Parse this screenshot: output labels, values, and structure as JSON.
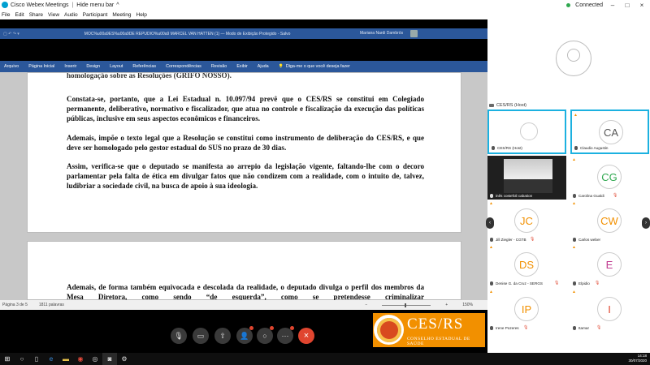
{
  "app": {
    "title": "Cisco Webex Meetings",
    "hide_menu": "Hide menu bar",
    "hide_menu_arrow": "^",
    "connection": "Connected"
  },
  "menu": [
    "File",
    "Edit",
    "Share",
    "View",
    "Audio",
    "Participant",
    "Meeting",
    "Help"
  ],
  "word": {
    "doc_title": "MOC%u00a9ES%u00a9DE REPUDIO%u00a9 MARCEL VAN HATTEN (1) — Modo de Exibição Protegido - Salvo",
    "user": "Mariana Nardi Dambrós",
    "ribbon_tabs": [
      "Arquivo",
      "Página Inicial",
      "Inserir",
      "Design",
      "Layout",
      "Referências",
      "Correspondências",
      "Revisão",
      "Exibir",
      "Ajuda"
    ],
    "tell_me": "Diga-me o que você deseja fazer",
    "paragraphs": [
      "homologação sobre as Resoluções (GRIFO NOSSO).",
      "Constata-se, portanto, que a Lei Estadual n. 10.097/94 prevê que o CES/RS se constitui em Colegiado permanente, deliberativo, normativo e fiscalizador, que atua no controle e fiscalização da execução das políticas públicas, inclusive em seus aspectos econômicos e financeiros.",
      "Ademais, impõe o texto legal que a Resolução se constitui como instrumento de deliberação do CES/RS, e que deve ser homologado pelo gestor estadual do SUS no prazo de 30 dias.",
      "Assim, verifica-se que o deputado se manifesta ao arrepio da legislação vigente, faltando-lhe com o decoro parlamentar pela falta de ética em divulgar fatos que não condizem com a realidade, com o intuito de, talvez, ludibriar a sociedade civil, na busca de apoio à sua ideologia.",
      "Ademais, de forma também equivocada e descolada da realidade, o deputado divulga o perfil dos membros da Mesa Diretora, como sendo “de esquerda”, como se pretendesse criminalizar"
    ],
    "status_page": "Página 3 de 5",
    "status_words": "1811 palavras",
    "zoom": "150%"
  },
  "branding": {
    "mark": "CES/RS",
    "subtitle": "CONSELHO ESTADUAL DE SAÚDE"
  },
  "panel": {
    "header": "CES/RS (Host)",
    "tiles": [
      {
        "name": "CES/RS (Host)",
        "initials": "",
        "color": "#888888"
      },
      {
        "name": "Claudio Augustin",
        "initials": "CA",
        "color": "#555555"
      },
      {
        "name": "inês costefoli cabation",
        "initials": "",
        "color": "#ffffff"
      },
      {
        "name": "Carolina Gualdi",
        "initials": "CG",
        "color": "#2fa84f"
      },
      {
        "name": "Jill Ziegler - CGTB",
        "initials": "JC",
        "color": "#f29000"
      },
      {
        "name": "Carlos weber",
        "initials": "CW",
        "color": "#f29000"
      },
      {
        "name": "Denise G. da Cruz - SERGS",
        "initials": "DS",
        "color": "#f29000"
      },
      {
        "name": "Elpidio",
        "initials": "E",
        "color": "#c0398f"
      },
      {
        "name": "Irene Pozeres",
        "initials": "IP",
        "color": "#f29000"
      },
      {
        "name": "Itamar",
        "initials": "I",
        "color": "#e0452f"
      }
    ]
  },
  "taskbar": {
    "time": "14:18",
    "date": "30/07/2020"
  }
}
